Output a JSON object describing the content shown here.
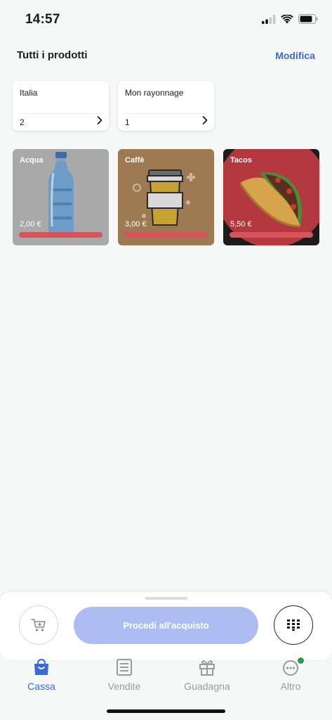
{
  "status_bar": {
    "time": "14:57",
    "icons": [
      "cellular-signal-icon",
      "wifi-icon",
      "battery-icon"
    ]
  },
  "header": {
    "title": "Tutti i prodotti",
    "edit_label": "Modifica"
  },
  "categories": [
    {
      "name": "Italia",
      "count": "2"
    },
    {
      "name": "Mon rayonnage",
      "count": "1"
    }
  ],
  "products": [
    {
      "name": "Acqua",
      "price": "2,00 €",
      "image": "water-bottle"
    },
    {
      "name": "Caffè",
      "price": "3,00 €",
      "image": "coffee-cup"
    },
    {
      "name": "Tacos",
      "price": "5,50 €",
      "image": "taco"
    }
  ],
  "checkout": {
    "button_label": "Procedi all'acquisto",
    "cart_icon": "cart-icon",
    "keypad_icon": "keypad-icon"
  },
  "tabs": [
    {
      "label": "Cassa",
      "icon": "shopping-bag-icon",
      "active": true
    },
    {
      "label": "Vendite",
      "icon": "receipt-list-icon",
      "active": false
    },
    {
      "label": "Guadagna",
      "icon": "gift-icon",
      "active": false
    },
    {
      "label": "Altro",
      "icon": "more-dots-icon",
      "active": false,
      "notification": true
    }
  ],
  "colors": {
    "accent": "#3a6bd6",
    "checkout_button": "#aebdf1",
    "price_bar": "#d9535c",
    "notification_dot": "#2e9a4c",
    "acqua_tile": "#a9a9a9",
    "caffe_tile": "#9e7a52",
    "tacos_tile": "#1c1c1c"
  }
}
